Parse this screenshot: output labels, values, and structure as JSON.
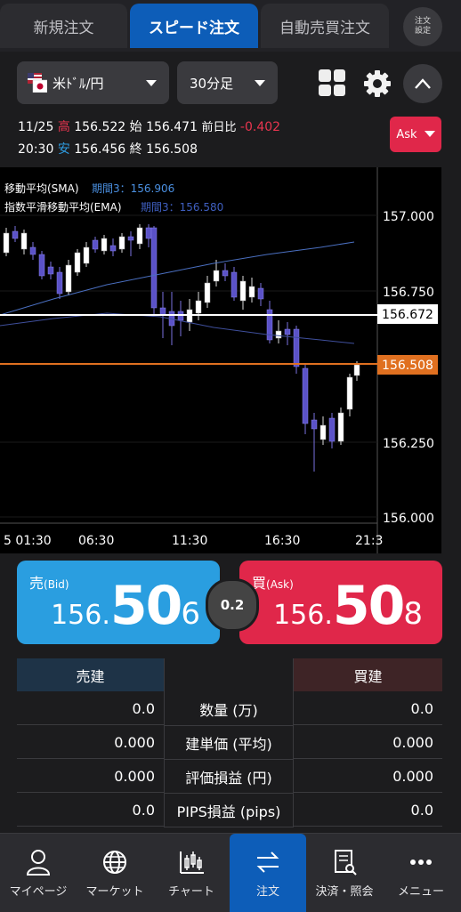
{
  "tabs": [
    {
      "label": "新規注文"
    },
    {
      "label": "スピード注文"
    },
    {
      "label": "自動売買注文"
    }
  ],
  "order_settings_label": [
    "注文",
    "設定"
  ],
  "pair": {
    "label": "米ﾄﾞﾙ/円"
  },
  "timeframe": {
    "label": "30分足"
  },
  "ohlc": {
    "date": "11/25",
    "time": "20:30",
    "high_label": "高",
    "high": "156.522",
    "open_label": "始",
    "open": "156.471",
    "change_label": "前日比",
    "change": "-0.402",
    "low_label": "安",
    "low": "156.456",
    "close_label": "終",
    "close": "156.508"
  },
  "ask_dropdown": "Ask",
  "chart": {
    "sma_label": "移動平均(SMA)",
    "sma_value": "期間3：156.906",
    "ema_label": "指数平滑移動平均(EMA)",
    "ema_value": "期間3：156.580",
    "y_ticks": [
      "157.000",
      "156.750",
      "156.250",
      "156.000"
    ],
    "current_line": "156.672",
    "price_line": "156.508",
    "x_ticks": [
      "5 01:30",
      "06:30",
      "11:30",
      "16:30",
      "21:3"
    ],
    "colors": {
      "up": "#ffffff",
      "down": "#5b52c8",
      "sma": "#4a6fc0",
      "ema": "#3f4f9c",
      "price_line": "#e07020"
    }
  },
  "bid": {
    "label": "売",
    "sub": "(Bid)",
    "p1": "156.",
    "p2": "50",
    "p3": "6"
  },
  "ask": {
    "label": "買",
    "sub": "(Ask)",
    "p1": "156.",
    "p2": "50",
    "p3": "8"
  },
  "spread": "0.2",
  "positions": {
    "sell_header": "売建",
    "buy_header": "買建",
    "rows": [
      {
        "label": "数量 (万)",
        "sell": "0.0",
        "buy": "0.0"
      },
      {
        "label": "建単価 (平均)",
        "sell": "0.000",
        "buy": "0.000"
      },
      {
        "label": "評価損益 (円)",
        "sell": "0.000",
        "buy": "0.000"
      },
      {
        "label": "PIPS損益 (pips)",
        "sell": "0.0",
        "buy": "0.0"
      }
    ]
  },
  "nav": [
    {
      "label": "マイページ",
      "icon": "person-icon"
    },
    {
      "label": "マーケット",
      "icon": "globe-icon"
    },
    {
      "label": "チャート",
      "icon": "candlestick-icon"
    },
    {
      "label": "注文",
      "icon": "transfer-arrows-icon"
    },
    {
      "label": "決済・照会",
      "icon": "document-search-icon"
    },
    {
      "label": "メニュー",
      "icon": "more-dots-icon"
    }
  ]
}
